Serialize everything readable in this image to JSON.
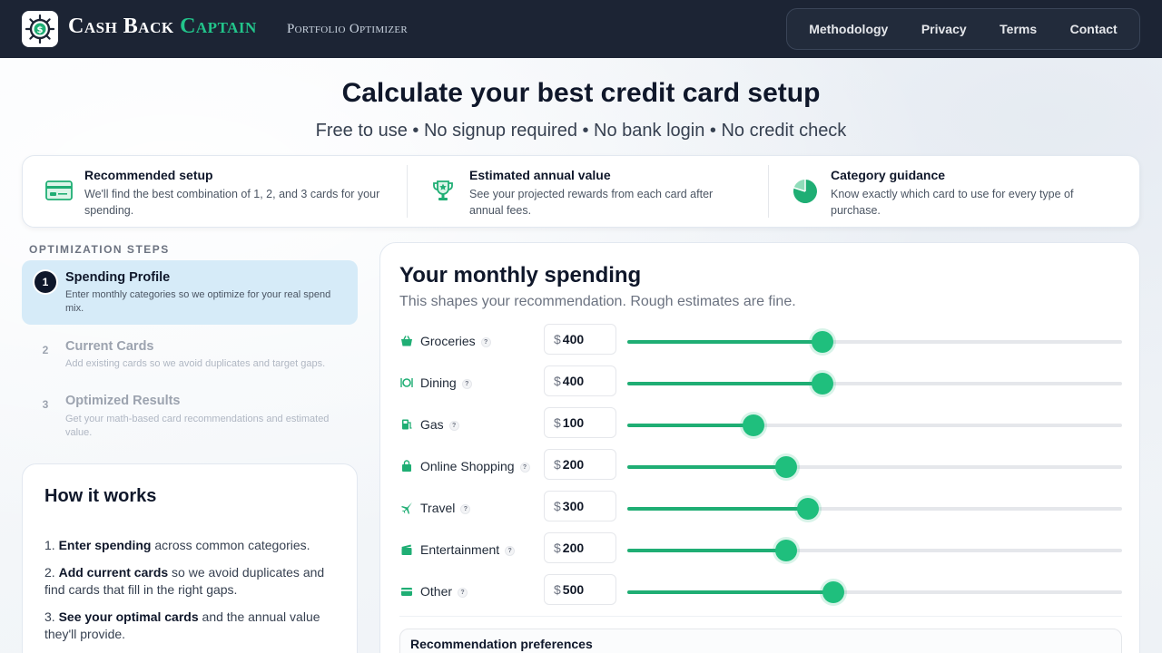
{
  "header": {
    "brand_part1": "Cash Back",
    "brand_part2": "Captain",
    "brand_sub": "Portfolio Optimizer",
    "nav": [
      "Methodology",
      "Privacy",
      "Terms",
      "Contact"
    ]
  },
  "hero": {
    "title": "Calculate your best credit card setup",
    "subtitle": "Free to use • No signup required • No bank login • No credit check"
  },
  "features": [
    {
      "icon": "credit-card-icon",
      "title": "Recommended setup",
      "desc": "We'll find the best combination of 1, 2, and 3 cards for your spending."
    },
    {
      "icon": "trophy-icon",
      "title": "Estimated annual value",
      "desc": "See your projected rewards from each card after annual fees."
    },
    {
      "icon": "pie-chart-icon",
      "title": "Category guidance",
      "desc": "Know exactly which card to use for every type of purchase."
    }
  ],
  "steps": {
    "label": "OPTIMIZATION STEPS",
    "items": [
      {
        "num": "1",
        "title": "Spending Profile",
        "desc": "Enter monthly categories so we optimize for your real spend mix."
      },
      {
        "num": "2",
        "title": "Current Cards",
        "desc": "Add existing cards so we avoid duplicates and target gaps."
      },
      {
        "num": "3",
        "title": "Optimized Results",
        "desc": "Get your math-based card recommendations and estimated value."
      }
    ]
  },
  "how": {
    "title": "How it works",
    "items": [
      {
        "num": "1.",
        "bold": "Enter spending",
        "rest": " across common categories."
      },
      {
        "num": "2.",
        "bold": "Add current cards",
        "rest": " so we avoid duplicates and find cards that fill in the right gaps."
      },
      {
        "num": "3.",
        "bold": "See your optimal cards",
        "rest": " and the annual value they'll provide."
      }
    ]
  },
  "spending": {
    "title": "Your monthly spending",
    "subtitle": "This shapes your recommendation. Rough estimates are fine.",
    "currency": "$",
    "help": "?",
    "categories": [
      {
        "label": "Groceries",
        "icon": "basket-icon",
        "value": "400",
        "level": 0.395
      },
      {
        "label": "Dining",
        "icon": "dining-icon",
        "value": "400",
        "level": 0.395
      },
      {
        "label": "Gas",
        "icon": "gas-pump-icon",
        "value": "100",
        "level": 0.255
      },
      {
        "label": "Online Shopping",
        "icon": "shopping-bag-icon",
        "value": "200",
        "level": 0.322
      },
      {
        "label": "Travel",
        "icon": "plane-icon",
        "value": "300",
        "level": 0.365
      },
      {
        "label": "Entertainment",
        "icon": "clapperboard-icon",
        "value": "200",
        "level": 0.322
      },
      {
        "label": "Other",
        "icon": "card-icon",
        "value": "500",
        "level": 0.417
      }
    ],
    "prefs_title": "Recommendation preferences"
  },
  "colors": {
    "accent": "#1fbf7d",
    "header_bg": "#1c2434",
    "step_active_bg": "#d6ebf8"
  }
}
